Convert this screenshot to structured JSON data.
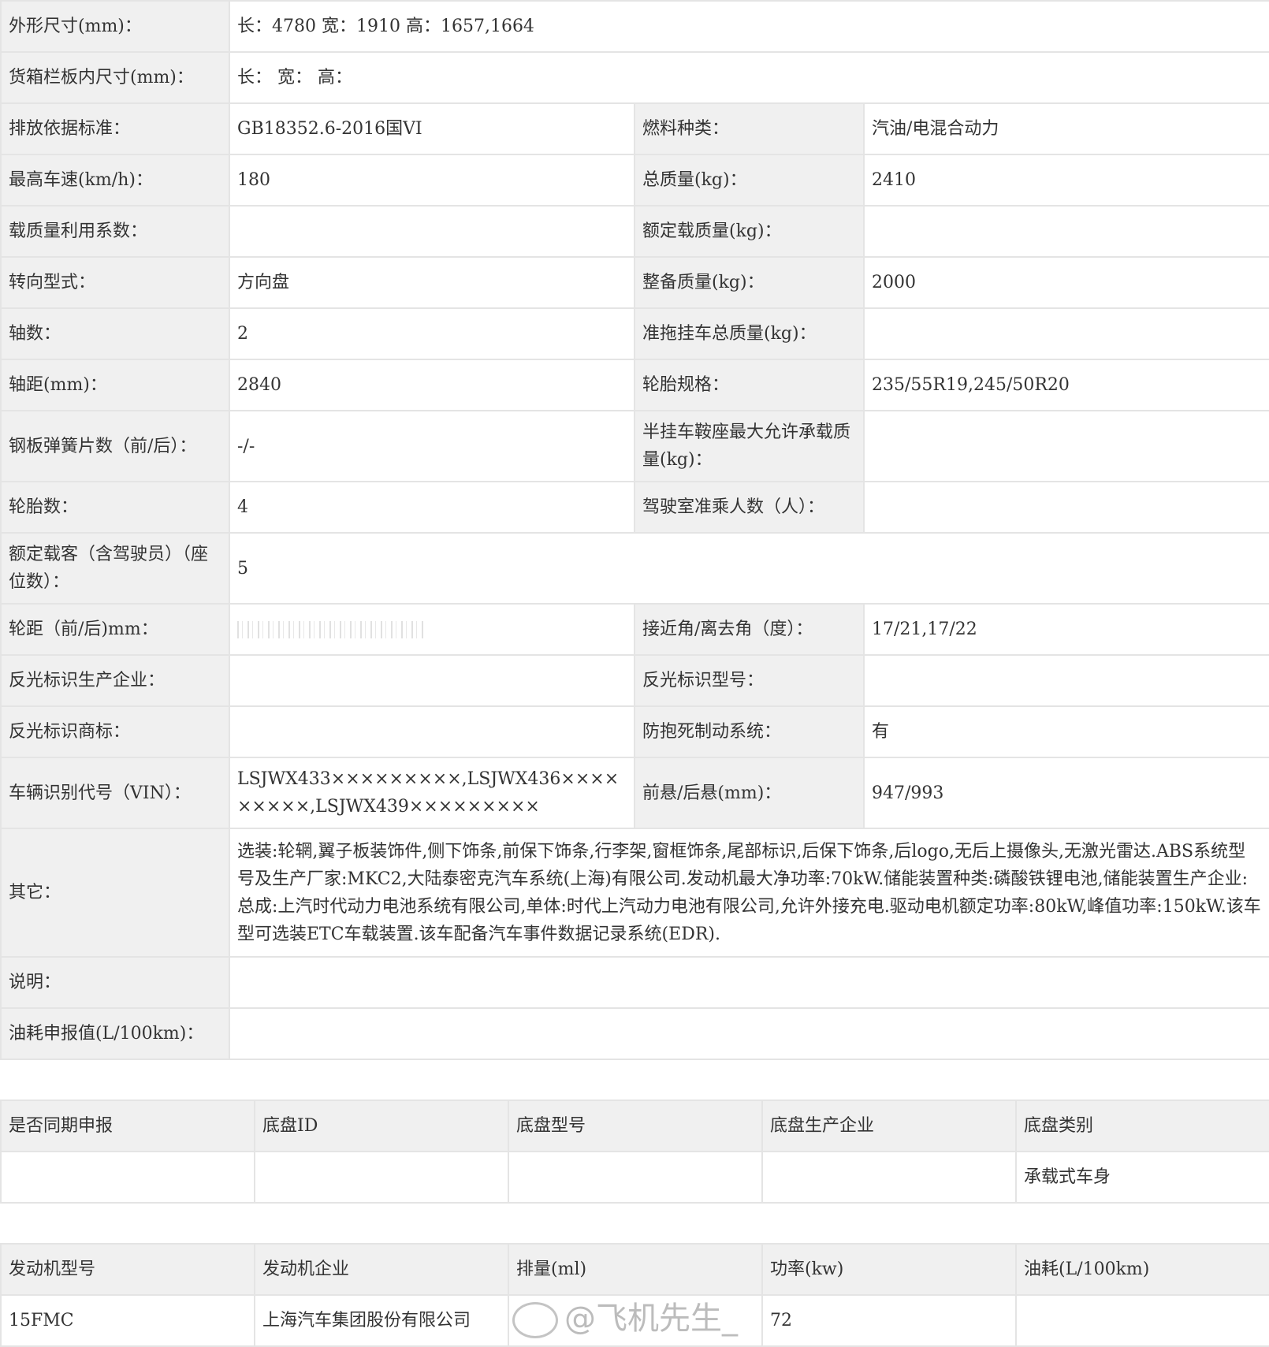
{
  "spec": {
    "r1": {
      "l": "外形尺寸(mm)：",
      "v": "长：4780 宽：1910 高：1657,1664"
    },
    "r2": {
      "l": "货箱栏板内尺寸(mm)：",
      "v": "长： 宽： 高："
    },
    "r3": {
      "l1": "排放依据标准：",
      "v1": "GB18352.6-2016国VI",
      "l2": "燃料种类：",
      "v2": "汽油/电混合动力"
    },
    "r4": {
      "l1": "最高车速(km/h)：",
      "v1": "180",
      "l2": "总质量(kg)：",
      "v2": "2410"
    },
    "r5": {
      "l1": "载质量利用系数：",
      "v1": "",
      "l2": "额定载质量(kg)：",
      "v2": ""
    },
    "r6": {
      "l1": "转向型式：",
      "v1": "方向盘",
      "l2": "整备质量(kg)：",
      "v2": "2000"
    },
    "r7": {
      "l1": "轴数：",
      "v1": "2",
      "l2": "准拖挂车总质量(kg)：",
      "v2": ""
    },
    "r8": {
      "l1": "轴距(mm)：",
      "v1": "2840",
      "l2": "轮胎规格：",
      "v2": "235/55R19,245/50R20"
    },
    "r9": {
      "l1": "钢板弹簧片数（前/后）：",
      "v1": "-/-",
      "l2": "半挂车鞍座最大允许承载质量(kg)：",
      "v2": ""
    },
    "r10": {
      "l1": "轮胎数：",
      "v1": "4",
      "l2": "驾驶室准乘人数（人）：",
      "v2": ""
    },
    "r11": {
      "l": "额定载客（含驾驶员）（座位数）：",
      "v": "5"
    },
    "r12": {
      "l1": "轮距（前/后)mm：",
      "v1": "",
      "l2": "接近角/离去角（度）：",
      "v2": "17/21,17/22"
    },
    "r13": {
      "l1": "反光标识生产企业：",
      "v1": "",
      "l2": "反光标识型号：",
      "v2": ""
    },
    "r14": {
      "l1": "反光标识商标：",
      "v1": "",
      "l2": "防抱死制动系统：",
      "v2": "有"
    },
    "r15": {
      "l1": "车辆识别代号（VIN）：",
      "v1": "LSJWX433×××××××××,LSJWX436×××××××××,LSJWX439×××××××××",
      "l2": "前悬/后悬(mm)：",
      "v2": "947/993"
    },
    "r16": {
      "l": "其它：",
      "v": "选装:轮辋,翼子板装饰件,侧下饰条,前保下饰条,行李架,窗框饰条,尾部标识,后保下饰条,后logo,无后上摄像头,无激光雷达.ABS系统型号及生产厂家:MKC2,大陆泰密克汽车系统(上海)有限公司.发动机最大净功率:70kW.储能装置种类:磷酸铁锂电池,储能装置生产企业:总成:上汽时代动力电池系统有限公司,单体:时代上汽动力电池有限公司,允许外接充电.驱动电机额定功率:80kW,峰值功率:150kW.该车型可选装ETC车载装置.该车配备汽车事件数据记录系统(EDR)."
    },
    "r17": {
      "l": "说明：",
      "v": ""
    },
    "r18": {
      "l": "油耗申报值(L/100km)：",
      "v": ""
    }
  },
  "chassis": {
    "headers": [
      "是否同期申报",
      "底盘ID",
      "底盘型号",
      "底盘生产企业",
      "底盘类别"
    ],
    "row": [
      "",
      "",
      "",
      "",
      "承载式车身"
    ]
  },
  "engine": {
    "headers": [
      "发动机型号",
      "发动机企业",
      "排量(ml)",
      "功率(kw)",
      "油耗(L/100km)"
    ],
    "row": [
      "15FMC",
      "上海汽车集团股份有限公司",
      "",
      "72",
      ""
    ]
  },
  "watermark": {
    "text": "@飞机先生_"
  }
}
